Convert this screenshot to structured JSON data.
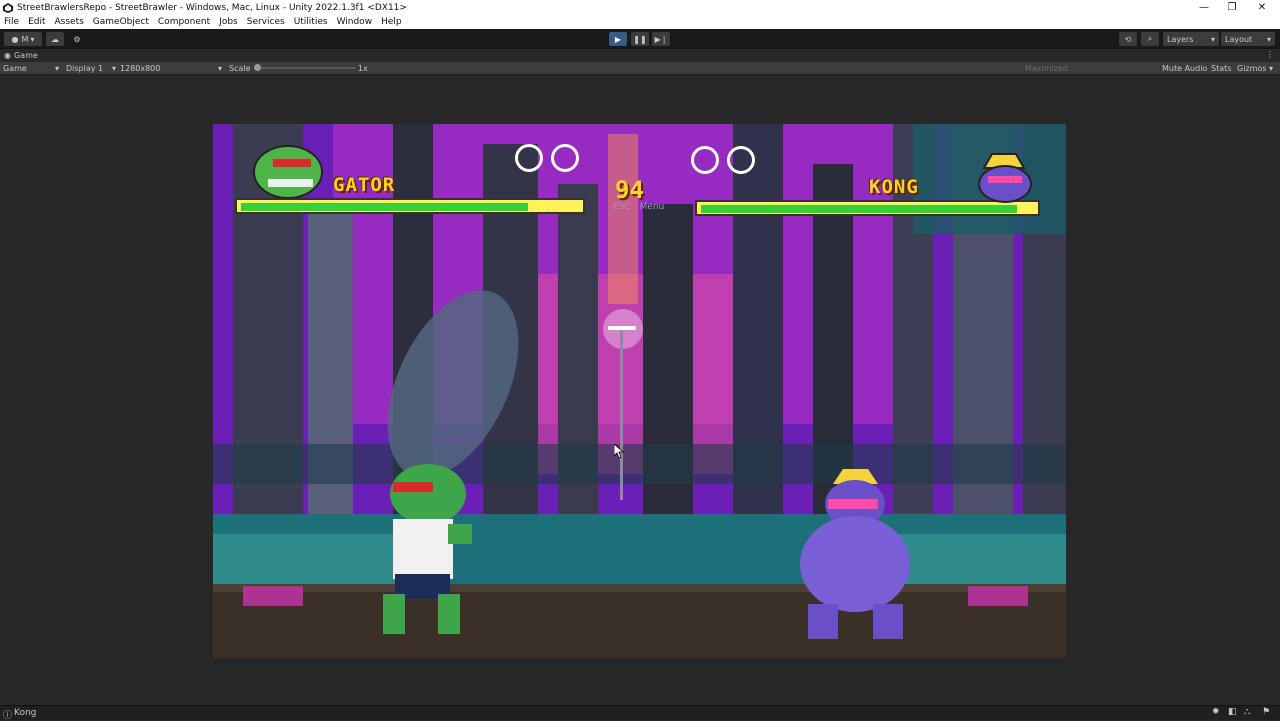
{
  "window": {
    "title": "StreetBrawlersRepo - StreetBrawler - Windows, Mac, Linux - Unity 2022.1.3f1 <DX11>",
    "controls": [
      "—",
      "❐",
      "✕"
    ]
  },
  "menu": [
    "File",
    "Edit",
    "Assets",
    "GameObject",
    "Component",
    "Jobs",
    "Services",
    "Utilities",
    "Window",
    "Help"
  ],
  "toolbar": {
    "account_label": "M",
    "layers_label": "Layers",
    "layout_label": "Layout"
  },
  "game_tab": {
    "title": "Game",
    "view_label": "Game",
    "display": "Display 1",
    "resolution": "1280x800",
    "scale_label": "Scale",
    "scale_value": "1x",
    "maximized": "Maximized",
    "mute_audio": "Mute Audio",
    "stats": "Stats",
    "gizmos": "Gizmos"
  },
  "hud": {
    "player1": {
      "name": "GATOR",
      "health": 0.85,
      "name_color": "#ffcf2c"
    },
    "player2": {
      "name": "KONG",
      "health": 0.95,
      "name_color": "#ffcf2c"
    },
    "timer": "94",
    "esc_hint": "ESC - Menu"
  },
  "status": {
    "text": "Kong"
  },
  "colors": {
    "hp_fill": "#35d13a",
    "hp_frame": "#fff25a",
    "play_active": "#3a5a8a"
  }
}
